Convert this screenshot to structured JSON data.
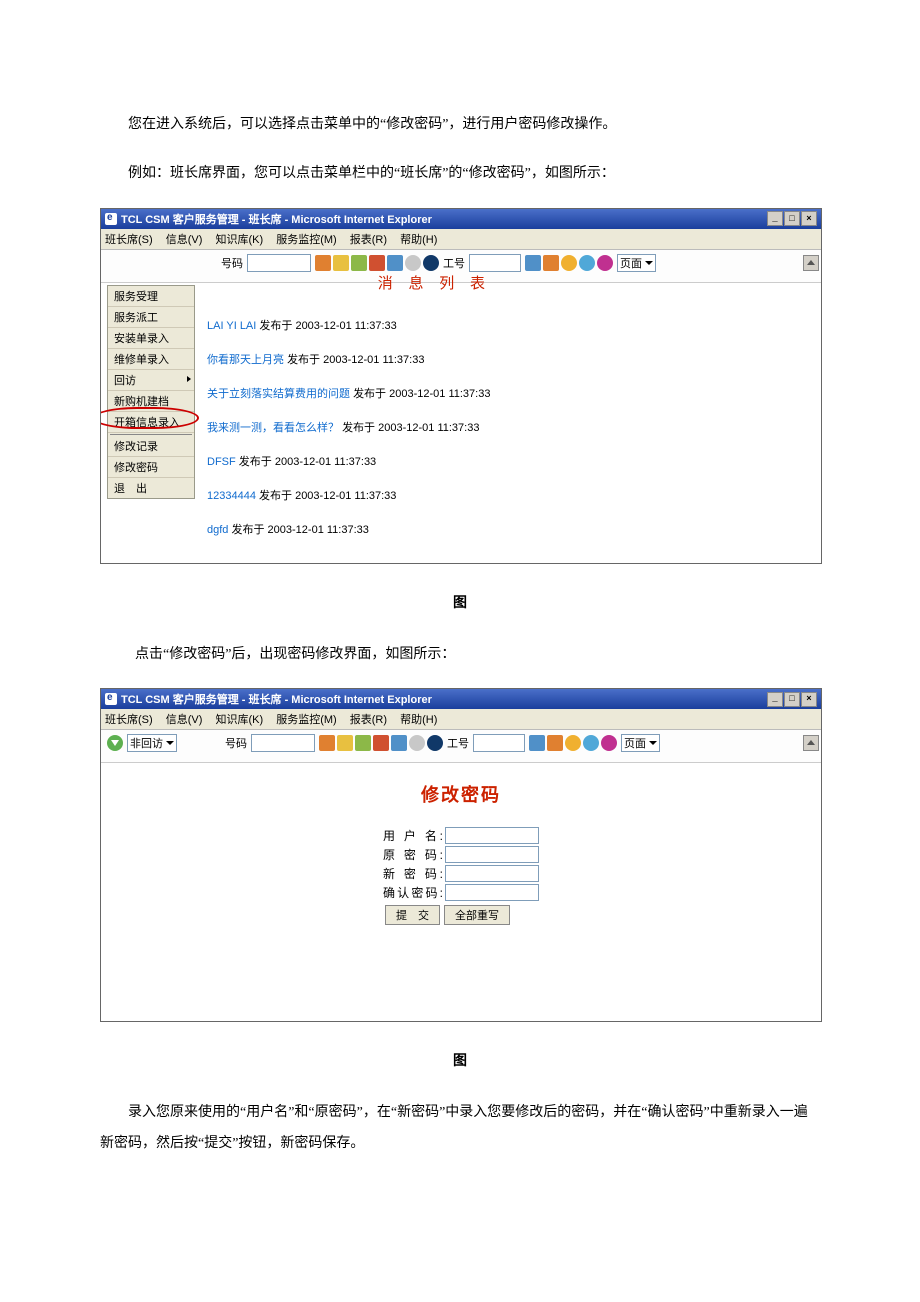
{
  "text": {
    "para1": "您在进入系统后，可以选择点击菜单中的“修改密码”，进行用户密码修改操作。",
    "para2": "例如：班长席界面，您可以点击菜单栏中的“班长席”的“修改密码”，如图所示：",
    "caption1": "图",
    "para3": "点击“修改密码”后，出现密码修改界面，如图所示：",
    "caption2": "图",
    "para4": "录入您原来使用的“用户名”和“原密码”，在“新密码”中录入您要修改后的密码，并在“确认密码”中重新录入一遍新密码，然后按“提交”按钮，新密码保存。"
  },
  "shot1": {
    "title": "TCL CSM 客户服务管理 - 班长席 - Microsoft Internet Explorer",
    "menubar": [
      "班长席(S)",
      "信息(V)",
      "知识库(K)",
      "服务监控(M)",
      "报表(R)",
      "帮助(H)"
    ],
    "sidebar": [
      {
        "label": "服务受理"
      },
      {
        "label": "服务派工"
      },
      {
        "label": "安装单录入"
      },
      {
        "label": "维修单录入"
      },
      {
        "label": "回访",
        "arrow": true
      },
      {
        "label": "新购机建档"
      },
      {
        "label": "开箱信息录入"
      },
      {
        "sep": true
      },
      {
        "label": "修改记录"
      },
      {
        "label": "修改密码",
        "highlight": true
      },
      {
        "label": "退　出"
      }
    ],
    "toolbar": {
      "label_number": "号码",
      "label_id": "工号",
      "page_label": "页面"
    },
    "banner": "消 息 列 表",
    "messages": [
      {
        "link": "LAI YI LAI",
        "meta": "发布于 2003-12-01 11:37:33"
      },
      {
        "link": "你看那天上月亮",
        "meta": "发布于 2003-12-01 11:37:33"
      },
      {
        "link": "关于立刻落实结算费用的问题",
        "meta": "发布于 2003-12-01 11:37:33"
      },
      {
        "link": "我来测一测，看看怎么样？",
        "meta": "发布于 2003-12-01 11:37:33"
      },
      {
        "link": "DFSF",
        "meta": "发布于 2003-12-01 11:37:33"
      },
      {
        "link": "12334444",
        "meta": "发布于 2003-12-01 11:37:33"
      },
      {
        "link": "dgfd",
        "meta": "发布于 2003-12-01 11:37:33"
      }
    ]
  },
  "shot2": {
    "title": "TCL CSM 客户服务管理 - 班长席 - Microsoft Internet Explorer",
    "menubar": [
      "班长席(S)",
      "信息(V)",
      "知识库(K)",
      "服务监控(M)",
      "报表(R)",
      "帮助(H)"
    ],
    "toolbar": {
      "dropdown1": "非回访",
      "label_number": "号码",
      "label_id": "工号",
      "page_label": "页面"
    },
    "form": {
      "title": "修改密码",
      "rows": [
        {
          "label": "用 户 名:"
        },
        {
          "label": "原 密 码:"
        },
        {
          "label": "新 密 码:"
        },
        {
          "label": "确认密码:"
        }
      ],
      "buttons": {
        "submit": "提　交",
        "reset": "全部重写"
      }
    }
  }
}
